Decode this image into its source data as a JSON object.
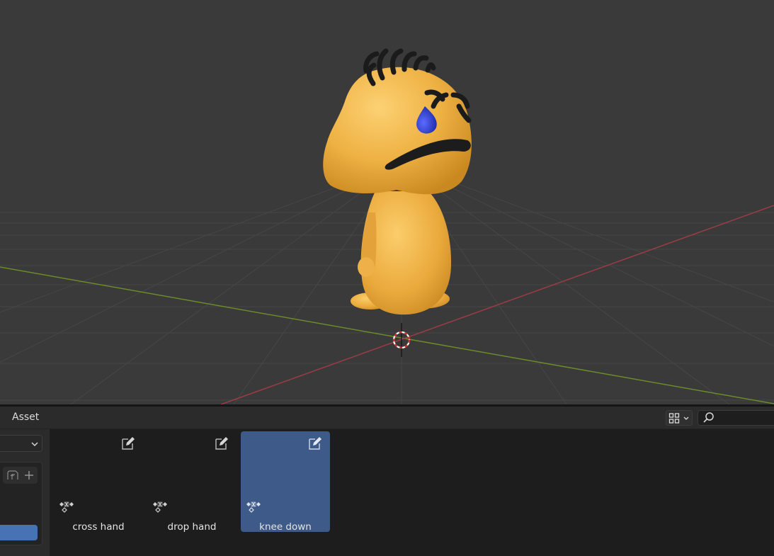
{
  "header": {
    "menu_asset_label": "Asset",
    "search_placeholder": ""
  },
  "side_panel": {
    "library_value": ""
  },
  "assets": [
    {
      "label": "cross hand",
      "selected": false
    },
    {
      "label": "drop hand",
      "selected": false
    },
    {
      "label": "knee down",
      "selected": true
    }
  ],
  "icons": {
    "display_mode": "grid-view-icon",
    "dropdown": "chevron-down-icon",
    "search": "search-icon",
    "edit": "edit-pose-icon",
    "asset_type": "pose-keyframe-icon",
    "catalog_new": "new-catalog-icon",
    "catalog_add": "plus-icon",
    "cursor": "3d-cursor-icon"
  },
  "colors": {
    "viewport_bg": "#3a3a3a",
    "grid_line": "#474747",
    "x_axis": "#9a3c48",
    "y_axis": "#6b8a2c",
    "selection": "#3d5a88",
    "accent": "#4772b3",
    "character_body": "#e8a93a"
  }
}
